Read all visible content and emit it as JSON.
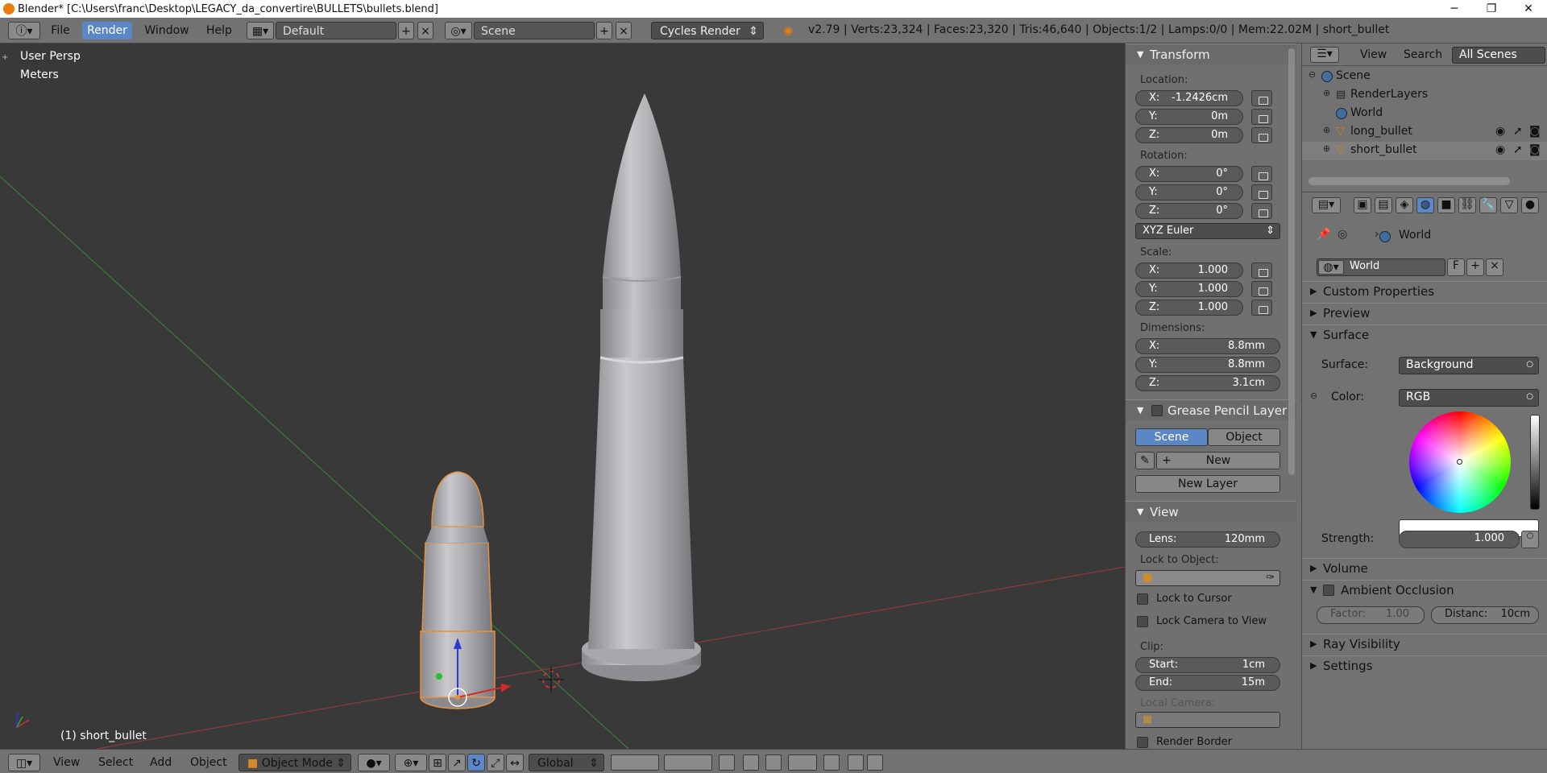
{
  "titlebar": {
    "title": "Blender* [C:\\Users\\franc\\Desktop\\LEGACY_da_convertire\\BULLETS\\bullets.blend]",
    "minimize": "─",
    "maximize": "❐",
    "close": "✕"
  },
  "topbar": {
    "menus": [
      "File",
      "Render",
      "Window",
      "Help"
    ],
    "layout": "Default",
    "scene": "Scene",
    "engine": "Cycles Render",
    "stats": "v2.79 | Verts:23,324 | Faces:23,320 | Tris:46,640 | Objects:1/2 | Lamps:0/0 | Mem:22.02M | short_bullet"
  },
  "viewport": {
    "view_name": "User Persp",
    "units": "Meters",
    "object_label": "(1) short_bullet"
  },
  "npanel": {
    "transform": {
      "title": "Transform",
      "location_label": "Location:",
      "location": [
        {
          "axis": "X:",
          "value": "-1.2426cm"
        },
        {
          "axis": "Y:",
          "value": "0m"
        },
        {
          "axis": "Z:",
          "value": "0m"
        }
      ],
      "rotation_label": "Rotation:",
      "rotation": [
        {
          "axis": "X:",
          "value": "0°"
        },
        {
          "axis": "Y:",
          "value": "0°"
        },
        {
          "axis": "Z:",
          "value": "0°"
        }
      ],
      "rotation_mode": "XYZ Euler",
      "scale_label": "Scale:",
      "scale": [
        {
          "axis": "X:",
          "value": "1.000"
        },
        {
          "axis": "Y:",
          "value": "1.000"
        },
        {
          "axis": "Z:",
          "value": "1.000"
        }
      ],
      "dimensions_label": "Dimensions:",
      "dimensions": [
        {
          "axis": "X:",
          "value": "8.8mm"
        },
        {
          "axis": "Y:",
          "value": "8.8mm"
        },
        {
          "axis": "Z:",
          "value": "3.1cm"
        }
      ]
    },
    "grease": {
      "title": "Grease Pencil Layer",
      "tab_scene": "Scene",
      "tab_object": "Object",
      "new": "New",
      "new_layer": "New Layer"
    },
    "view": {
      "title": "View",
      "lens_label": "Lens:",
      "lens": "120mm",
      "lock_to_object": "Lock to Object:",
      "lock_cursor": "Lock to Cursor",
      "lock_camera": "Lock Camera to View",
      "clip": "Clip:",
      "start_label": "Start:",
      "start": "1cm",
      "end_label": "End:",
      "end": "15m",
      "local_camera": "Local Camera:",
      "render_border": "Render Border"
    }
  },
  "outliner": {
    "view": "View",
    "search": "Search",
    "scenes": "All Scenes",
    "items": [
      {
        "name": "Scene"
      },
      {
        "name": "RenderLayers"
      },
      {
        "name": "World"
      },
      {
        "name": "long_bullet"
      },
      {
        "name": "short_bullet"
      }
    ]
  },
  "properties": {
    "breadcrumb": "World",
    "world_name": "World",
    "fake_user": "F",
    "sections": {
      "custom": "Custom Properties",
      "preview": "Preview",
      "surface": "Surface",
      "volume": "Volume",
      "ao": "Ambient Occlusion",
      "ray": "Ray Visibility",
      "settings": "Settings"
    },
    "surface_label": "Surface:",
    "surface_value": "Background",
    "color_label": "Color:",
    "color_value": "RGB",
    "strength_label": "Strength:",
    "strength_value": "1.000",
    "factor_label": "Factor:",
    "factor_value": "1.00",
    "distance_label": "Distanc:",
    "distance_value": "10cm"
  },
  "bottombar": {
    "view": "View",
    "select": "Select",
    "add": "Add",
    "object": "Object",
    "mode": "Object Mode",
    "orientation": "Global"
  }
}
